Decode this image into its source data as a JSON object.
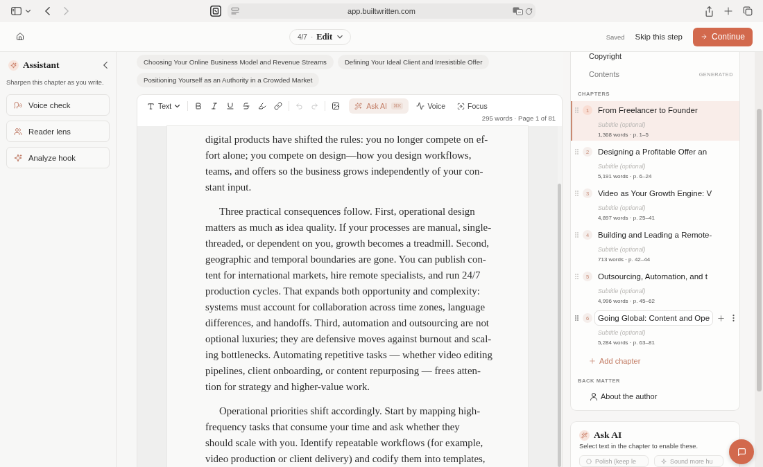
{
  "browser": {
    "url": "app.builtwritten.com",
    "forward_disabled": true
  },
  "header": {
    "step": "4/7",
    "separator": "·",
    "mode": "Edit",
    "save_status": "Saved",
    "skip": "Skip this step",
    "continue": "Continue"
  },
  "assistant": {
    "title": "Assistant",
    "subtitle": "Sharpen this chapter as you write.",
    "actions": [
      {
        "kind": "voice",
        "label": "Voice check"
      },
      {
        "kind": "reader",
        "label": "Reader lens"
      },
      {
        "kind": "hook",
        "label": "Analyze hook"
      }
    ]
  },
  "chapter_chips": [
    {
      "label": "Choosing Your Online Business Model and Revenue Streams"
    },
    {
      "label": "Defining Your Ideal Client and Irresistible Offer"
    },
    {
      "label": "Positioning Yourself as an Authority in a Crowded Market"
    }
  ],
  "toolbar": {
    "text_style": "Text",
    "undo_disabled": true,
    "redo_disabled": true,
    "ask_ai": "Ask AI",
    "ask_ai_shortcut": "⌘K",
    "voice": "Voice",
    "focus": "Focus"
  },
  "editor": {
    "stats": "295 words · Page 1 of 81",
    "paragraphs": [
      {
        "indent": false,
        "lines": [
          "digital products have shifted the rules: you no longer compete on ef-",
          "fort alone; you compete on design—how you design workflows,",
          "teams, and offers so the business grows independently of your con-",
          "stant input."
        ]
      },
      {
        "indent": true,
        "lines": [
          "Three practical consequences follow. First, operational design",
          "matters as much as idea quality. If your processes are manual, single-",
          "threaded, or dependent on you, growth becomes a treadmill. Second,",
          "geographic and temporal boundaries are gone. You can publish con-",
          "tent for international markets, hire remote specialists, and run 24/7",
          "production cycles. That expands both opportunity and complexity:",
          "systems must account for collaboration across time zones, language",
          "differences, and handoffs. Third, automation and outsourcing are not",
          "optional luxuries; they are defensive moves against burnout and scal-",
          "ing bottlenecks. Automating repetitive tasks — whether video editing",
          "pipelines, client onboarding, or content repurposing — frees atten-",
          "tion for strategy and higher-value work."
        ]
      },
      {
        "indent": true,
        "lines": [
          "Operational priorities shift accordingly. Start by mapping high-",
          "frequency tasks that consume your time and ask whether they",
          "should scale with you. Identify repeatable workflows (for example,",
          "video production or client delivery) and codify them into templates,"
        ]
      }
    ]
  },
  "outline": {
    "front_matter": [
      {
        "label": "Copyright"
      },
      {
        "label": "Contents",
        "badge": "GENERATED"
      }
    ],
    "chapters_heading": "CHAPTERS",
    "chapters": [
      {
        "number": "1",
        "title": "From Freelancer to Founder",
        "subtitle_placeholder": "Subtitle (optional)",
        "meta": "1,368 words · p. 1–5",
        "selected": true,
        "hover": false
      },
      {
        "number": "2",
        "title": "Designing a Profitable Offer an",
        "subtitle_placeholder": "Subtitle (optional)",
        "meta": "5,191 words · p. 6–24",
        "selected": false,
        "hover": false
      },
      {
        "number": "3",
        "title": "Video as Your Growth Engine: V",
        "subtitle_placeholder": "Subtitle (optional)",
        "meta": "4,897 words · p. 25–41",
        "selected": false,
        "hover": false
      },
      {
        "number": "4",
        "title": "Building and Leading a Remote-",
        "subtitle_placeholder": "Subtitle (optional)",
        "meta": "713 words · p. 42–44",
        "selected": false,
        "hover": false
      },
      {
        "number": "5",
        "title": "Outsourcing, Automation, and t",
        "subtitle_placeholder": "Subtitle (optional)",
        "meta": "4,996 words · p. 45–62",
        "selected": false,
        "hover": false
      },
      {
        "number": "6",
        "title": "Going Global: Content and Ope",
        "subtitle_placeholder": "Subtitle (optional)",
        "meta": "5,284 words · p. 63–81",
        "selected": false,
        "hover": true
      }
    ],
    "add_chapter": "Add chapter",
    "back_matter_heading": "BACK MATTER",
    "back_matter": [
      {
        "label": "About the author"
      }
    ]
  },
  "ask_ai_panel": {
    "title": "Ask AI",
    "hint": "Select text in the chapter to enable these.",
    "actions": [
      {
        "kind": "polish",
        "label": "Polish (keep le",
        "disabled": true
      },
      {
        "kind": "humanize",
        "label": "Sound more hu",
        "disabled": true
      }
    ]
  }
}
